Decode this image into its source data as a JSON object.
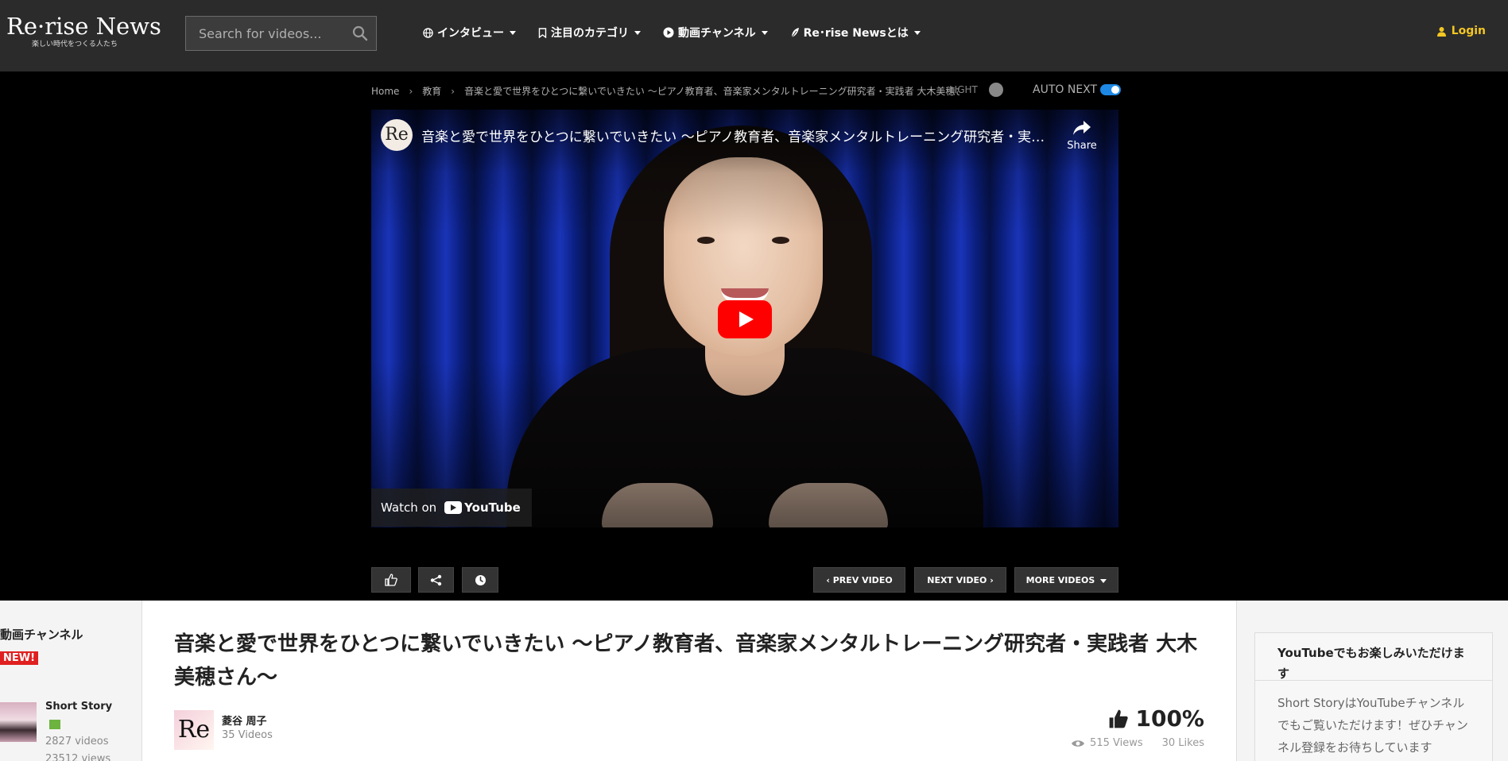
{
  "header": {
    "logo_main": "Re·rise News",
    "logo_sub": "楽しい時代をつくる人たち",
    "search_placeholder": "Search for videos...",
    "nav": [
      {
        "label": "インタビュー",
        "icon": "globe-icon"
      },
      {
        "label": "注目のカテゴリ",
        "icon": "bookmark-icon"
      },
      {
        "label": "動画チャンネル",
        "icon": "play-circle-icon"
      },
      {
        "label": "Re･rise Newsとは",
        "icon": "leaf-icon"
      }
    ],
    "login_label": "Login"
  },
  "breadcrumb": {
    "home": "Home",
    "category": "教育",
    "current": "音楽と愛で世界をひとつに繋いでいきたい ～ピアノ教育者、音楽家メンタルトレーニング研究者・実践者 大木美穂さん～"
  },
  "player": {
    "light_label": "LIGHT",
    "auto_next_label": "AUTO NEXT",
    "auto_next_on": true,
    "yt_avatar_text": "Re",
    "yt_title": "音楽と愛で世界をひとつに繋いでいきたい ～ピアノ教育者、音楽家メンタルトレーニング研究者・実践者 大木美穂さん～",
    "share_label": "Share",
    "watch_on_label": "Watch on",
    "youtube_label": "YouTube",
    "prev_label": "PREV VIDEO",
    "next_label": "NEXT VIDEO",
    "more_label": "MORE VIDEOS"
  },
  "left_sidebar": {
    "title": "動画チャンネル",
    "badge": "NEW!",
    "channel": {
      "name": "Short Story",
      "videos": "2827 videos",
      "views": "23512 views"
    }
  },
  "main": {
    "title": "音楽と愛で世界をひとつに繋いでいきたい ～ピアノ教育者、音楽家メンタルトレーニング研究者・実践者 大木美穂さん～",
    "author_avatar_text": "Re",
    "author_name": "菱谷 周子",
    "author_videos": "35 Videos",
    "rating": "100%",
    "views": "515 Views",
    "likes": "30 Likes"
  },
  "right_sidebar": {
    "widget_title": "YouTubeでもお楽しみいただけます",
    "widget_body": "Short StoryはYouTubeチャンネルでもご覧いただけます！ぜひチャンネル登録をお待ちしています"
  },
  "colors": {
    "header_bg": "#2b2b2b",
    "login_accent": "#f3c623",
    "toggle_on": "#1e88e5",
    "badge_red": "#e02020",
    "youtube_red": "#ff0000"
  }
}
